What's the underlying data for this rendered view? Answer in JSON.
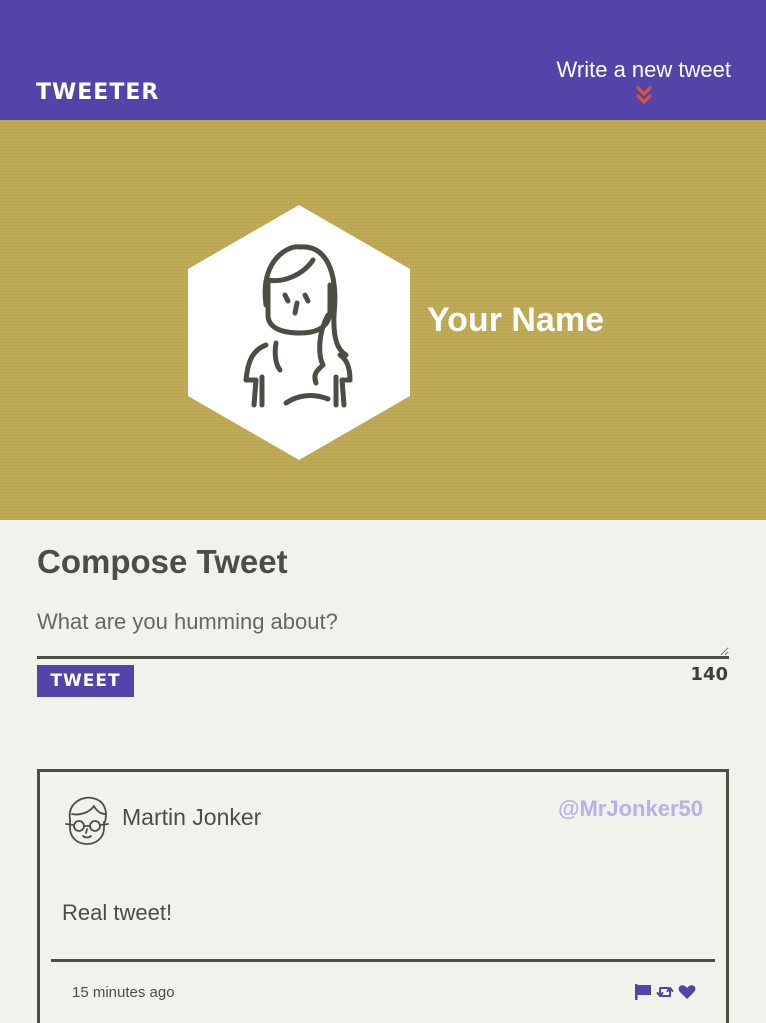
{
  "nav": {
    "logo": "TWEETER",
    "compose_toggle": "Write a new tweet",
    "chevron_icon": "double-chevron-down-icon",
    "chevron_color": "#e0532c"
  },
  "profile": {
    "name": "Your Name",
    "avatar_icon": "female-user-avatar"
  },
  "compose": {
    "title": "Compose Tweet",
    "placeholder": "What are you humming about?",
    "submit_label": "TWEET",
    "counter": "140"
  },
  "tweets": [
    {
      "author": "Martin Jonker",
      "handle": "@MrJonker50",
      "content": "Real tweet!",
      "timestamp": "15 minutes ago",
      "avatar_icon": "male-user-avatar-with-glasses",
      "actions": [
        "flag-icon",
        "retweet-icon",
        "heart-icon"
      ]
    }
  ],
  "colors": {
    "nav": "#5344a9",
    "banner": "#bfa954",
    "page": "#f3f1ec",
    "text": "#4d4d45",
    "handle": "#b8b1e8",
    "accent": "#5344a9"
  }
}
